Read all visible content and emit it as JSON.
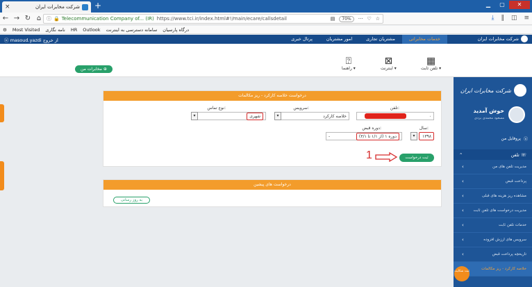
{
  "browser": {
    "tab_title": "شرکت مخابرات ایران",
    "tab_close": "×",
    "new_tab": "+",
    "url_site": "Telecommunication Company of... (IR)",
    "url_path": "https://www.tci.ir/index.html#!/main/ecare/callsdetail",
    "zoom": "70%",
    "bookmarks": [
      "Most Visited",
      "نامه نگاری",
      "HR",
      "Outlook",
      "سامانه دسترسی به اینترنت",
      "درگاه پارسیان"
    ]
  },
  "app": {
    "user": "masoud.yazdi از خروج",
    "logo_text": "شرکت مخابرات ایران",
    "top_menu": [
      "خدمات مخابراتی",
      "مشتریان تجاری",
      "امور مشتریان",
      "پرتال خبری"
    ],
    "my_comm_button": "مخابرات من",
    "sub_nav": [
      {
        "icon": "landline-icon",
        "label": "تلفن ثابت ▾"
      },
      {
        "icon": "internet-icon",
        "label": "اینترنت ▾"
      },
      {
        "icon": "help-icon",
        "label": "راهنما ▾"
      }
    ]
  },
  "sidebar": {
    "logo_text": "شرکت مخابرات ایران",
    "welcome": "خوش آمدید",
    "user_name": "مسعود محمدی یزدی",
    "profile": "پروفایل من",
    "section": "تلفن",
    "items": [
      "مدیریت تلفن های من",
      "پرداخت قبض",
      "مشاهده ریز هزینه های قبلی",
      "مدیریت درخواست های تلفن ثابت",
      "خدمات تلفن ثابت",
      "سرویس های ارزش افزوده",
      "تاریخچه پرداخت قبض",
      "خلاصه کارکرد - ریز مکالمات"
    ],
    "fab_label": "ثبت شکایت"
  },
  "form": {
    "header": "درخواست خلاصه کارکرد - ریز مکالمات",
    "phone_label": "تلفن:",
    "phone_prefix": "۰",
    "service_label": "سرویس:",
    "service_value": "خلاصه کارکرد",
    "call_type_label": "نوع تماس:",
    "call_type_value": "شهری",
    "year_label": "سال:",
    "year_value": "۱۳۹۸",
    "period_label": "دوره قبض:",
    "period_value": "دوره ۱ (از ۱/۱ تا ۳/۱)",
    "period_extra": "-",
    "submit_label": "ثبت درخواست",
    "annotation": "1"
  },
  "previous": {
    "header": "درخواست های پیشین",
    "refresh_label": "به روز رسانی"
  }
}
